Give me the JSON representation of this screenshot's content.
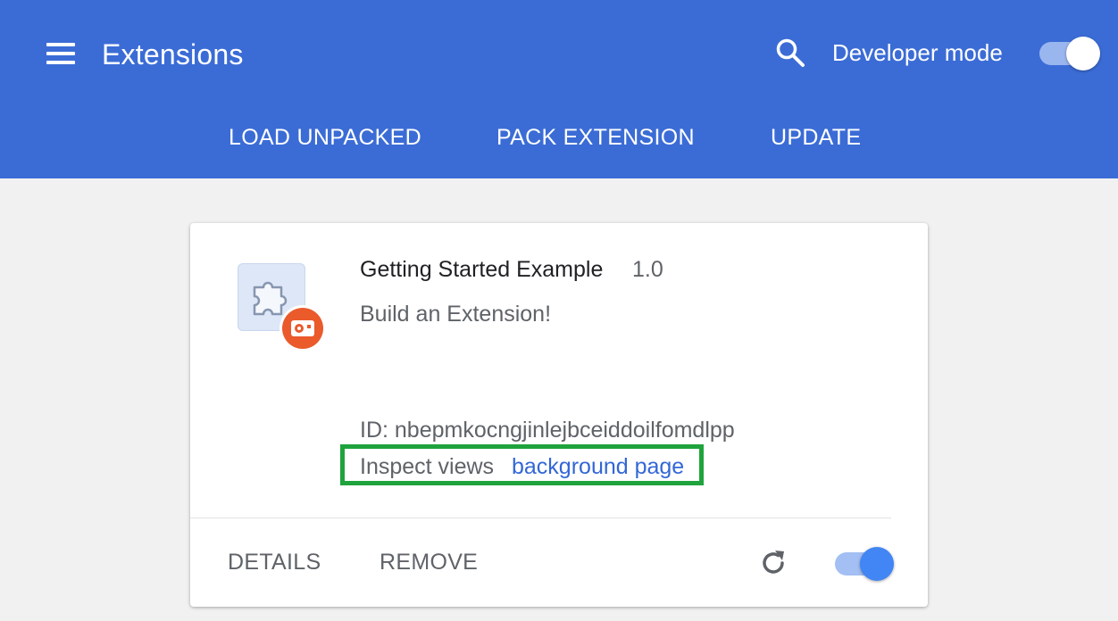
{
  "header": {
    "title": "Extensions",
    "developer_mode_label": "Developer mode",
    "developer_mode_on": true,
    "background_color": "#3b6cd6"
  },
  "toolbar": {
    "load_unpacked": "LOAD UNPACKED",
    "pack_extension": "PACK EXTENSION",
    "update": "UPDATE"
  },
  "extension": {
    "name": "Getting Started Example",
    "version": "1.0",
    "description": "Build an Extension!",
    "id_text": "ID: nbepmkocngjinlejbceiddoilfomdlpp",
    "inspect_views_label": "Inspect views",
    "inspect_views_link": "background page",
    "enabled": true,
    "details_label": "DETAILS",
    "remove_label": "REMOVE",
    "icon": "puzzle-piece-icon",
    "badge_icon": "error-badge-icon"
  },
  "highlight_color": "#1fa33c",
  "link_color": "#3367d6"
}
